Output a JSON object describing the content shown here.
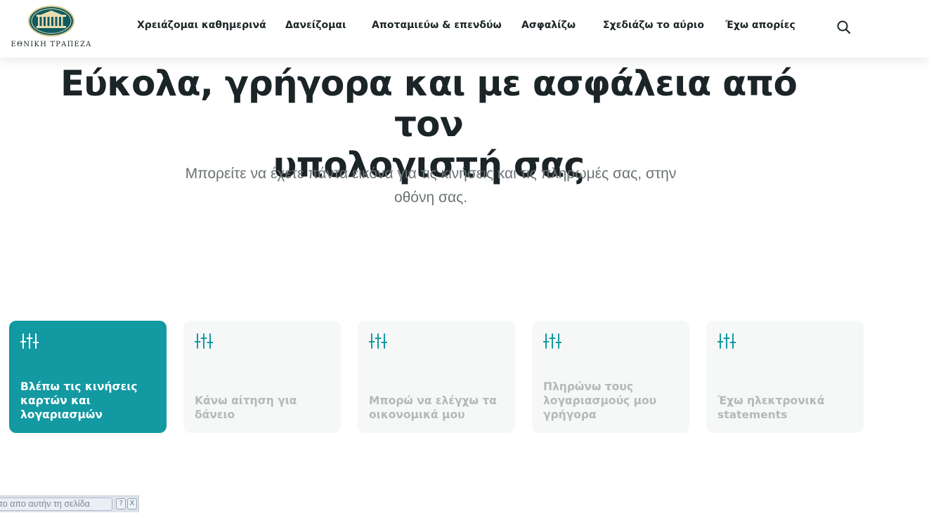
{
  "brand": {
    "name": "ΕΘΝΙΚΗ ΤΡΑΠΕΖΑ",
    "accent": "#1299a2",
    "text": "#1b2426"
  },
  "nav": {
    "items": [
      "Χρειάζομαι καθημερινά",
      "Δανείζομαι",
      "Αποταμιεύω & επενδύω",
      "Ασφαλίζω",
      "Σχεδιάζω το αύριο",
      "Έχω απορίες"
    ],
    "search_icon": "search-icon"
  },
  "hero": {
    "title_line1": "Εύκολα, γρήγορα και με ασφάλεια από τον",
    "title_line2": "υπολογιστή σας",
    "subtitle_line1": "Μπορείτε να έχετε πάντα εικόνα για τις κινήσεις και τις πληρωμές σας, στην",
    "subtitle_line2": "οθόνη σας."
  },
  "cards": [
    {
      "label": "Βλέπω τις κινήσεις καρτών και λογαριασμών",
      "active": true,
      "icon": "sliders-icon"
    },
    {
      "label": "Κάνω αίτηση για δάνειο",
      "active": false,
      "icon": "sliders-icon"
    },
    {
      "label": "Μπορώ να ελέγχω τα οικονομικά μου",
      "active": false,
      "icon": "sliders-icon"
    },
    {
      "label": "Πληρώνω τους λογαριασμούς μου γρήγορα",
      "active": false,
      "icon": "sliders-icon"
    },
    {
      "label": "Έχω ηλεκτρονικά statements",
      "active": false,
      "icon": "sliders-icon"
    }
  ],
  "translate_bar": {
    "text": "το απο αυτήν τη σελίδα",
    "help_label": "?",
    "close_label": "X"
  }
}
